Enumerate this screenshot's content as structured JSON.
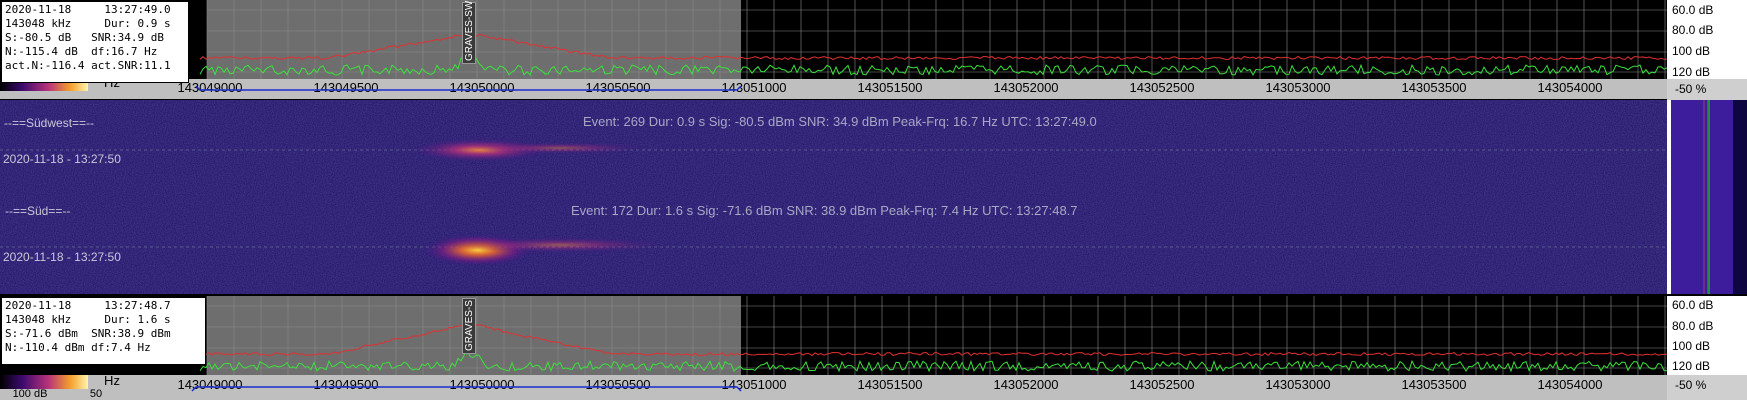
{
  "top_info": {
    "date": "2020-11-18",
    "time": "13:27:49.0",
    "freq": "143048 kHz",
    "dur": "Dur: 0.9 s",
    "signal": "S:-80.5 dB",
    "snr": "SNR:34.9 dB",
    "noise": "N:-115.4 dB",
    "df": "df:16.7 Hz",
    "act_noise": "act.N:-116.4",
    "act_snr": "act.SNR:11.1"
  },
  "bottom_info": {
    "date": "2020-11-18",
    "time": "13:27:48.7",
    "freq": "143048 kHz",
    "dur": "Dur: 1.6 s",
    "signal": "S:-71.6 dBm",
    "snr": "SNR:38.9 dBm",
    "noise": "N:-110.4 dBm",
    "df": "df:7.4 Hz"
  },
  "db_axis": [
    "60.0 dB",
    "80.0 dB",
    "100 dB",
    "120 dB"
  ],
  "freq_axis": [
    "143049000",
    "143049500",
    "143050000",
    "143050500",
    "143051000",
    "143051500",
    "143052000",
    "143052500",
    "143053000",
    "143053500",
    "143054000"
  ],
  "ruler_fragment_top": "Hz",
  "ruler_fragment_bottom": "Hz",
  "colorbar_label_bottom": "100 dB",
  "colorbar_label_bottom_right": "50",
  "percent_top": "-50 %",
  "percent_bottom": "-50 %",
  "markers": {
    "top": "GRAVES-SW",
    "bottom": "GRAVES-S"
  },
  "waterfall": {
    "channel1": {
      "name": "--==Südwest==--",
      "event": "Event: 269   Dur: 0.9 s   Sig: -80.5 dBm   SNR: 34.9 dBm   Peak-Frq: 16.7 Hz   UTC: 13:27:49.0",
      "timestamp": "2020-11-18 - 13:27:50"
    },
    "channel2": {
      "name": "--==Süd==--",
      "event": "Event: 172   Dur: 1.6 s   Sig: -71.6 dBm   SNR: 38.9 dBm   Peak-Frq: 7.4 Hz   UTC: 13:27:48.7",
      "timestamp": "2020-11-18 - 13:27:50"
    }
  },
  "colors": {
    "trace_green": "#39e23a",
    "trace_red": "#e23030",
    "waterfall_bg": "#1a0f5c",
    "grid": "#8a8a8a",
    "level_line": "#2fbf3f"
  }
}
